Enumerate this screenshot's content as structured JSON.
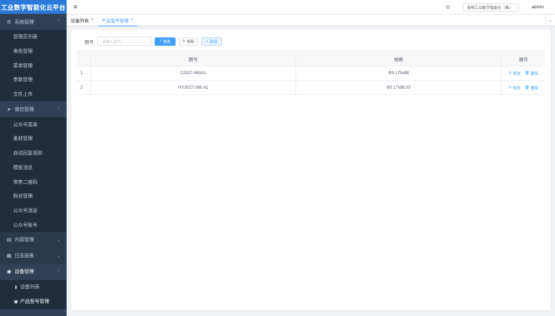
{
  "app": {
    "title": "工业数字智能化云平台"
  },
  "sidebar": {
    "groups": [
      {
        "label": "系统管理",
        "icon": "gear-icon",
        "expanded": true,
        "items": [
          {
            "label": "管理员列表"
          },
          {
            "label": "角色管理"
          },
          {
            "label": "菜单管理"
          },
          {
            "label": "参数管理"
          },
          {
            "label": "文件上传"
          }
        ]
      },
      {
        "label": "微信管理",
        "icon": "send-icon",
        "expanded": true,
        "items": [
          {
            "label": "公众号菜单"
          },
          {
            "label": "素材管理"
          },
          {
            "label": "自动回复规则"
          },
          {
            "label": "模板消息"
          },
          {
            "label": "带参二维码"
          },
          {
            "label": "粉丝管理"
          },
          {
            "label": "公众号消息"
          },
          {
            "label": "公众号账号"
          }
        ]
      },
      {
        "label": "内容管理",
        "icon": "document-icon",
        "expanded": false,
        "items": []
      },
      {
        "label": "日志报表",
        "icon": "report-icon",
        "expanded": false,
        "items": []
      },
      {
        "label": "设备管理",
        "icon": "device-icon",
        "expanded": true,
        "items": [
          {
            "label": "设备列表",
            "icon": "bar-chart-icon"
          },
          {
            "label": "产品型号管理",
            "icon": "image-icon",
            "active": true
          }
        ]
      }
    ]
  },
  "header": {
    "company": "昆明工业数字智能化（集）",
    "user": "admin"
  },
  "tags": [
    {
      "label": "设备列表",
      "active": false
    },
    {
      "label": "产品型号管理",
      "active": true
    }
  ],
  "search": {
    "label": "图号",
    "placeholder": "请输入图号",
    "search_button": "搜索",
    "reset_button": "刷新",
    "add_button": "新增"
  },
  "table": {
    "columns": [
      "",
      "图号",
      "规格",
      "操作"
    ],
    "rows": [
      {
        "index": "1",
        "tuhao": "C0027-060A1",
        "guige": "Φ3.175x98",
        "edit": "修改",
        "delete": "删除"
      },
      {
        "index": "2",
        "tuhao": "HY.0027.060.A1",
        "guige": "Φ3.17x98.03",
        "edit": "修改",
        "delete": "删除"
      }
    ]
  },
  "colors": {
    "sidebar_bg": "#304156",
    "logo_bg": "#2b7ad9",
    "accent": "#409eff"
  }
}
